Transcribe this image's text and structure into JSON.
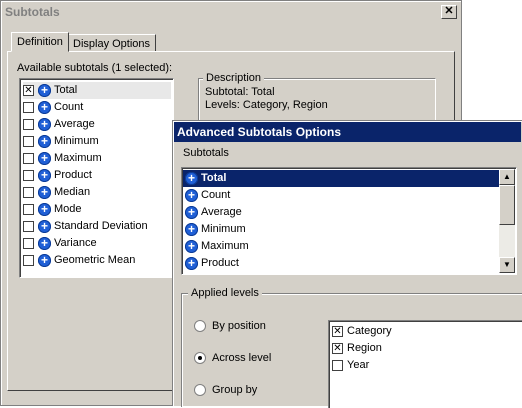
{
  "subtotals_dialog": {
    "title": "Subtotals",
    "close_glyph": "✕",
    "tabs": [
      {
        "label": "Definition"
      },
      {
        "label": "Display Options"
      }
    ],
    "available_label": "Available subtotals (1 selected):",
    "items": [
      {
        "label": "Total",
        "checked": true
      },
      {
        "label": "Count",
        "checked": false
      },
      {
        "label": "Average",
        "checked": false
      },
      {
        "label": "Minimum",
        "checked": false
      },
      {
        "label": "Maximum",
        "checked": false
      },
      {
        "label": "Product",
        "checked": false
      },
      {
        "label": "Median",
        "checked": false
      },
      {
        "label": "Mode",
        "checked": false
      },
      {
        "label": "Standard Deviation",
        "checked": false
      },
      {
        "label": "Variance",
        "checked": false
      },
      {
        "label": "Geometric Mean",
        "checked": false
      }
    ],
    "description": {
      "legend": "Description",
      "line1": "Subtotal: Total",
      "line2": "Levels: Category, Region"
    }
  },
  "advanced_dialog": {
    "title": "Advanced Subtotals Options",
    "subtotals_label": "Subtotals",
    "items": [
      {
        "label": "Total",
        "selected": true
      },
      {
        "label": "Count"
      },
      {
        "label": "Average"
      },
      {
        "label": "Minimum"
      },
      {
        "label": "Maximum"
      },
      {
        "label": "Product"
      }
    ],
    "applied_levels": {
      "legend": "Applied levels",
      "options": [
        {
          "label": "By position",
          "selected": false
        },
        {
          "label": "Across level",
          "selected": true
        },
        {
          "label": "Group by",
          "selected": false
        }
      ],
      "levels": [
        {
          "label": "Category",
          "checked": true
        },
        {
          "label": "Region",
          "checked": true
        },
        {
          "label": "Year",
          "checked": false
        }
      ]
    }
  },
  "glyphs": {
    "check": "✕",
    "plus": "+",
    "arrow_up": "▲",
    "arrow_down": "▼"
  },
  "colors": {
    "face": "#d4d0c8",
    "title_active": "#0a246a",
    "icon_blue": "#1f5fd6"
  }
}
